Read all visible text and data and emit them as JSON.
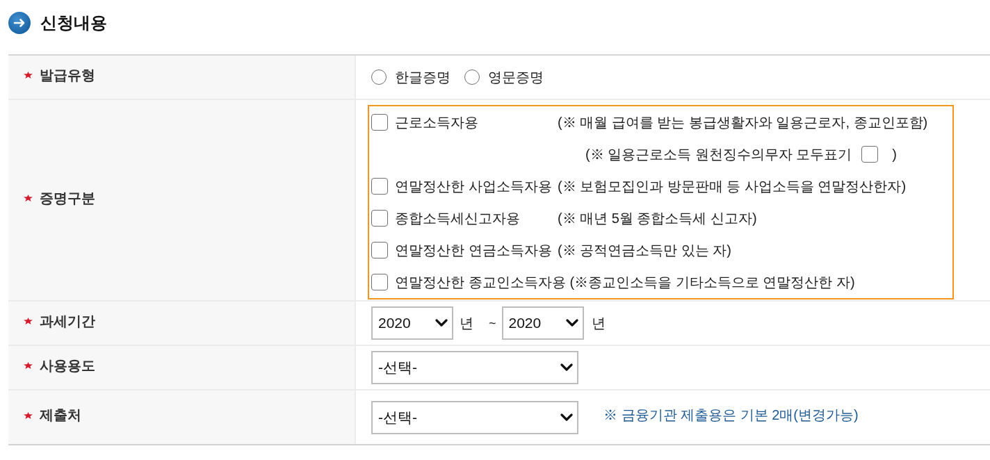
{
  "section": {
    "title": "신청내용"
  },
  "fields": [
    {
      "kind": "radio",
      "label": "발급유형",
      "required": true,
      "options": [
        {
          "label": "한글증명",
          "selected": false
        },
        {
          "label": "영문증명",
          "selected": false
        }
      ]
    },
    {
      "kind": "checklist",
      "label": "증명구분",
      "required": true,
      "highlighted": true,
      "options": [
        {
          "label": "근로소득자용",
          "note": "(※ 매월 급여를 받는 봉급생활자와 일용근로자, 종교인포함)",
          "checked": false,
          "sub_option": {
            "text": "(※ 일용근로소득 원천징수의무자 모두표기",
            "checked": false,
            "closing": ")"
          }
        },
        {
          "label": "연말정산한 사업소득자용",
          "note": "(※ 보험모집인과 방문판매 등 사업소득을 연말정산한자)",
          "checked": false
        },
        {
          "label": "종합소득세신고자용",
          "note": "(※ 매년 5월 종합소득세 신고자)",
          "checked": false
        },
        {
          "label": "연말정산한 연금소득자용",
          "note": "(※ 공적연금소득만 있는 자)",
          "checked": false
        },
        {
          "label": "연말정산한 종교인소득자용",
          "note": "(※종교인소득을 기타소득으로 연말정산한 자)",
          "checked": false
        }
      ]
    },
    {
      "kind": "period",
      "label": "과세기간",
      "required": true,
      "from": {
        "value": "2020",
        "unit": "년"
      },
      "separator": "~",
      "to": {
        "value": "2020",
        "unit": "년"
      }
    },
    {
      "kind": "select",
      "label": "사용용도",
      "required": true,
      "value": "-선택-"
    },
    {
      "kind": "select",
      "label": "제출처",
      "required": true,
      "value": "-선택-",
      "note": "※ 금융기관 제출용은 기본 2매(변경가능)"
    }
  ]
}
